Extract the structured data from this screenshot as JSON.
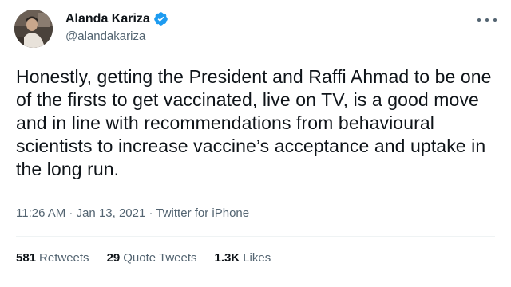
{
  "author": {
    "display_name": "Alanda Kariza",
    "handle": "@alandakariza",
    "verified": true
  },
  "tweet": {
    "text": "Honestly, getting the President and Raffi Ahmad to be one of the firsts to get vaccinated, live on TV, is a good move and in line with recommendations from behavioural scientists to increase vaccine’s acceptance and uptake in the long run.",
    "meta": "11:26 AM · Jan 13, 2021 · Twitter for iPhone"
  },
  "stats": {
    "retweets": {
      "count": "581",
      "label": "Retweets"
    },
    "quote_tweets": {
      "count": "29",
      "label": "Quote Tweets"
    },
    "likes": {
      "count": "1.3K",
      "label": "Likes"
    }
  },
  "icons": {
    "verified": "verified-badge-icon",
    "more": "more-options-icon"
  },
  "colors": {
    "verified_blue": "#1d9bf0",
    "secondary_text": "#536471",
    "primary_text": "#0f1419"
  }
}
